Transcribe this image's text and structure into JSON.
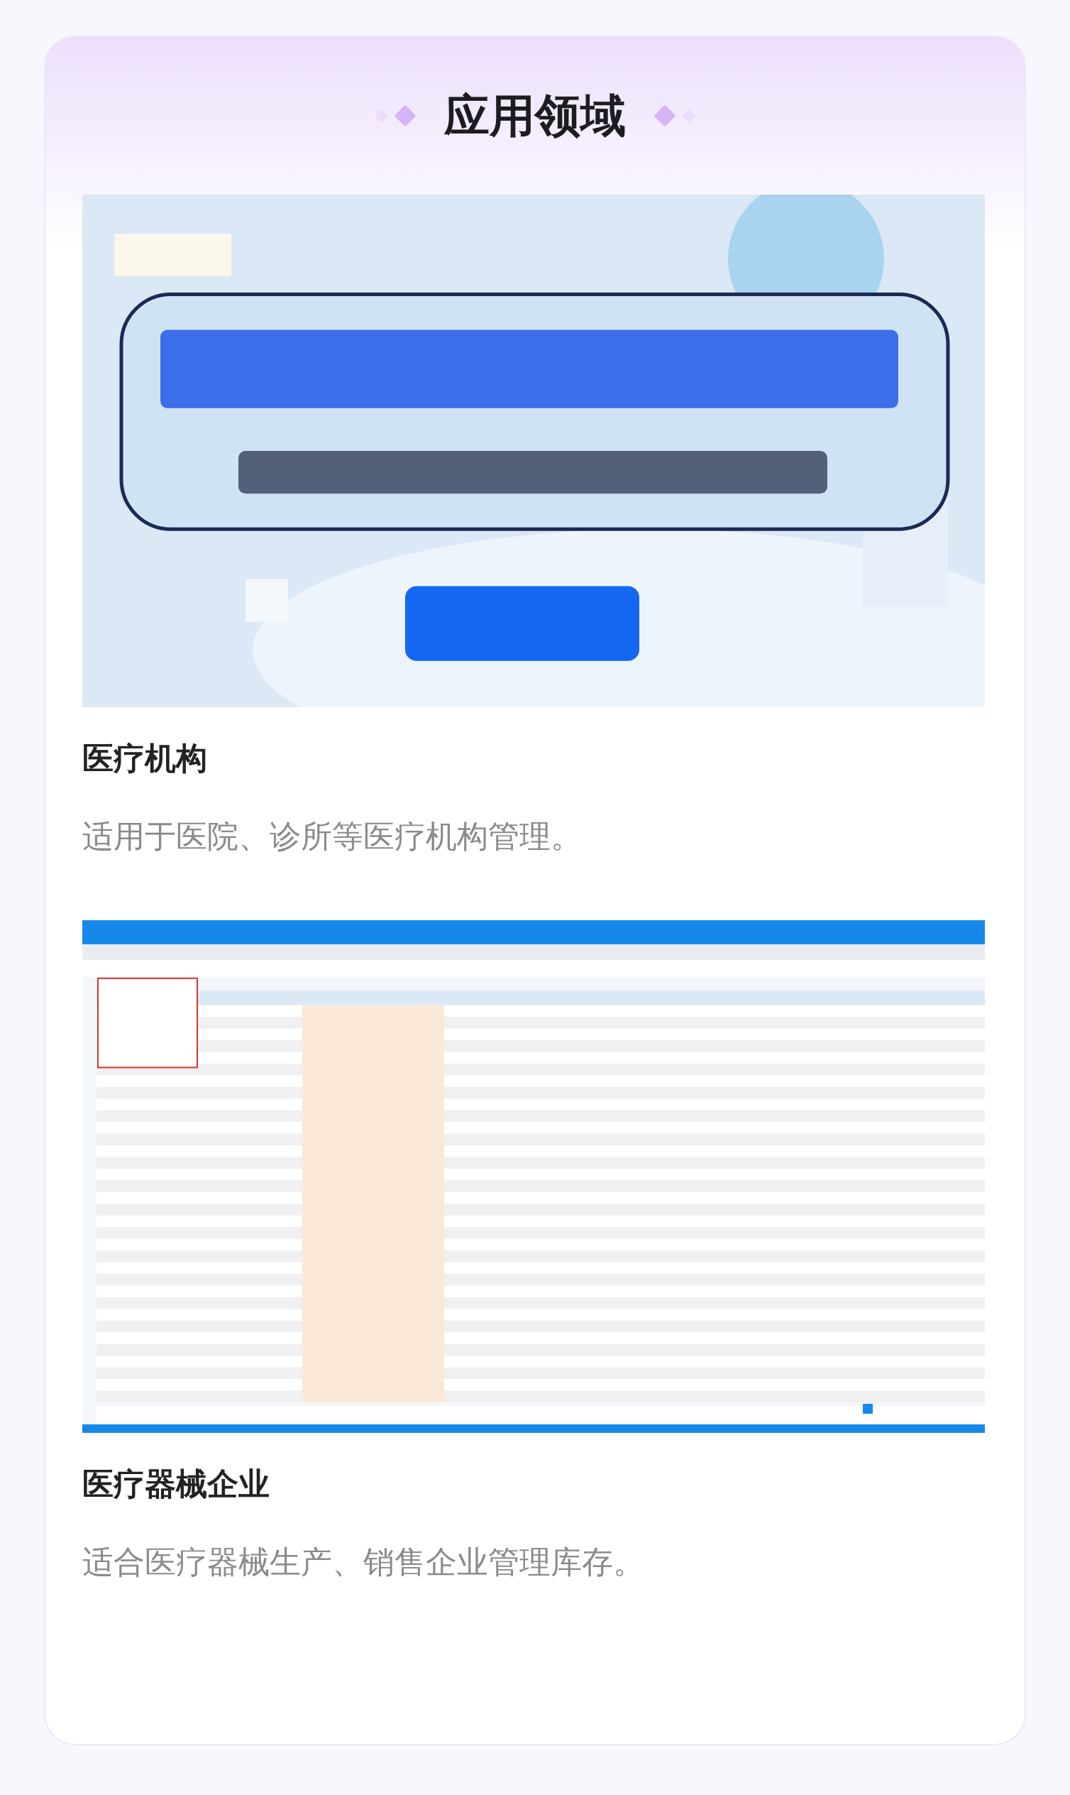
{
  "section_title": "应用领域",
  "items": [
    {
      "title": "医疗机构",
      "description": "适用于医院、诊所等医疗机构管理。"
    },
    {
      "title": "医疗器械企业",
      "description": "适合医疗器械生产、销售企业管理库存。"
    }
  ]
}
